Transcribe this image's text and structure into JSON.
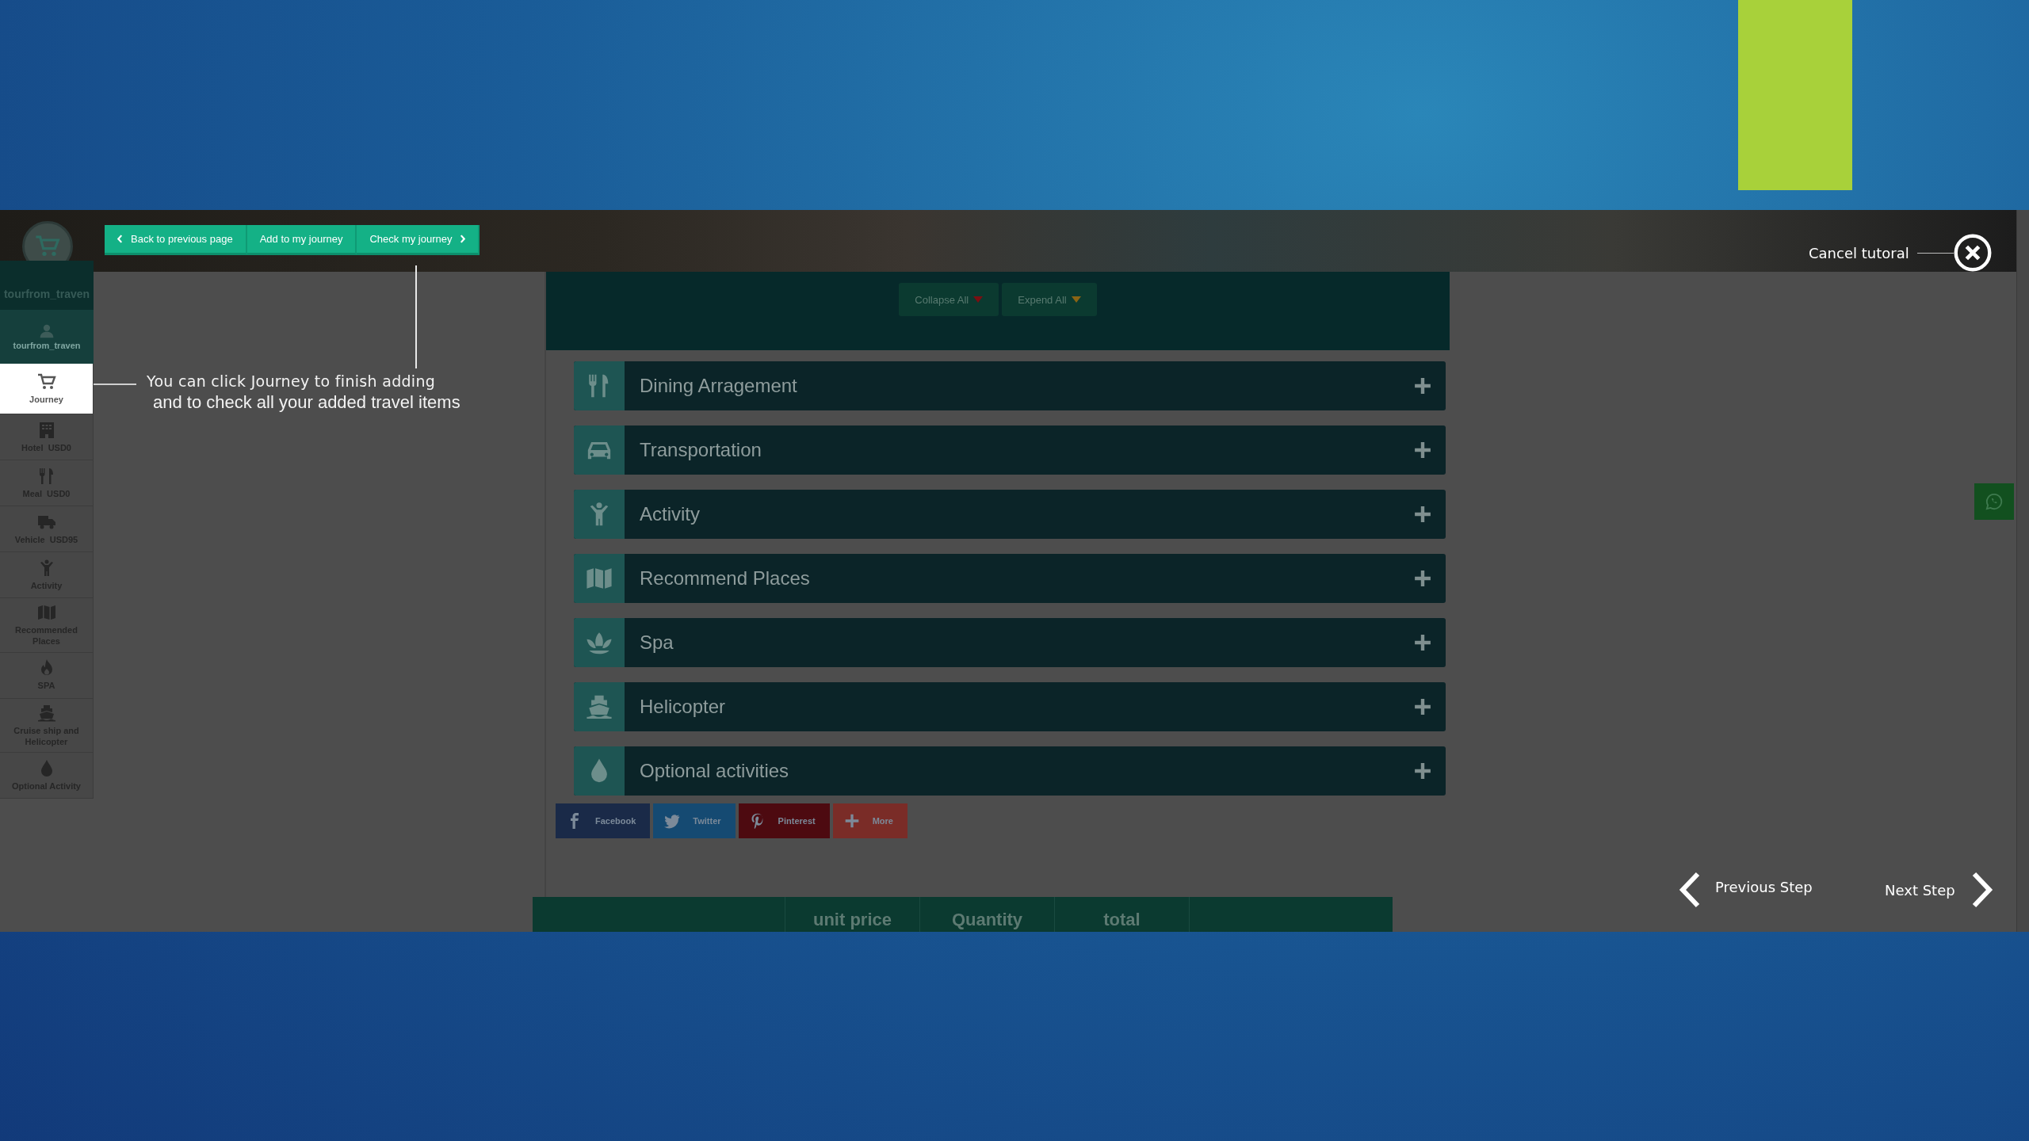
{
  "header": {
    "buttons": [
      {
        "label": "Back to previous page",
        "kind": "back"
      },
      {
        "label": "Add to my journey",
        "kind": "plain"
      },
      {
        "label": "Check my journey",
        "kind": "forward"
      }
    ]
  },
  "sidebar": {
    "account_name": "tourfrom_traven",
    "user_label": "tourfrom_traven",
    "items": [
      {
        "label": "Journey",
        "kind": "cart",
        "selected": true
      },
      {
        "label": "Hotel  USD0",
        "kind": "building",
        "selected": false
      },
      {
        "label": "Meal  USD0",
        "kind": "utensils",
        "selected": false
      },
      {
        "label": "Vehicle  USD95",
        "kind": "truck",
        "selected": false
      },
      {
        "label": "Activity",
        "kind": "person",
        "selected": false
      },
      {
        "label": "Recommended Places",
        "kind": "map",
        "selected": false
      },
      {
        "label": "SPA",
        "kind": "flame",
        "selected": false
      },
      {
        "label": "Cruise ship and Helicopter",
        "kind": "ship",
        "selected": false
      },
      {
        "label": "Optional Activity",
        "kind": "drop",
        "selected": false
      }
    ]
  },
  "toolbar": {
    "collapse": "Collapse All",
    "expand": "Expend All"
  },
  "sections": [
    {
      "title": "Dining Arragement",
      "kind": "utensils",
      "expanded": false
    },
    {
      "title": "Transportation",
      "kind": "car",
      "expanded": false
    },
    {
      "title": "Activity",
      "kind": "person",
      "expanded": false
    },
    {
      "title": "Recommend Places",
      "kind": "map",
      "expanded": false
    },
    {
      "title": "Spa",
      "kind": "lotus",
      "expanded": false
    },
    {
      "title": "Helicopter",
      "kind": "ship",
      "expanded": false
    },
    {
      "title": "Optional activities",
      "kind": "drop",
      "expanded": false
    }
  ],
  "share": [
    {
      "label": "Facebook",
      "kind": "facebook"
    },
    {
      "label": "Twitter",
      "kind": "twitter"
    },
    {
      "label": "Pinterest",
      "kind": "pinterest"
    },
    {
      "label": "More",
      "kind": "more"
    }
  ],
  "table": {
    "columns": [
      "unit price",
      "Quantity",
      "total"
    ]
  },
  "tutorial": {
    "hint_lines": [
      "You can click Journey to finish adding",
      "and to check all your added travel items"
    ],
    "cancel": "Cancel tutoral",
    "previous": "Previous Step",
    "next": "Next Step"
  }
}
